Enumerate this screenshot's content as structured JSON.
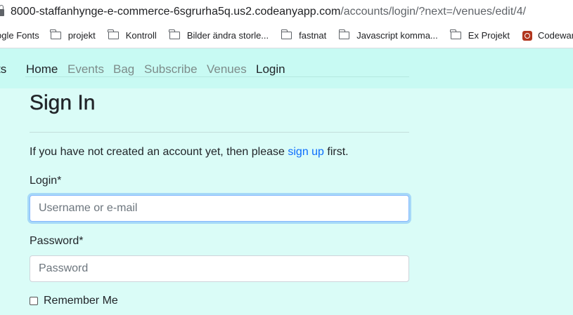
{
  "browser": {
    "url_host": "8000-staffanhynge-e-commerce-6sgrurha5q.us2.codeanyapp.com",
    "url_path": "/accounts/login/?next=/venues/edit/4/",
    "bookmarks": [
      {
        "label": "ogle Fonts",
        "icon": "none"
      },
      {
        "label": "projekt",
        "icon": "folder-icon"
      },
      {
        "label": "Kontroll",
        "icon": "folder-icon"
      },
      {
        "label": "Bilder ändra storle...",
        "icon": "folder-icon"
      },
      {
        "label": "fastnat",
        "icon": "folder-icon"
      },
      {
        "label": "Javascript komma...",
        "icon": "folder-icon"
      },
      {
        "label": "Ex Projekt",
        "icon": "folder-icon"
      },
      {
        "label": "Codewars -",
        "icon": "codewars-icon"
      }
    ]
  },
  "navbar": {
    "brand_tail": "ts",
    "items": [
      {
        "label": "Home",
        "active": true
      },
      {
        "label": "Events",
        "active": false
      },
      {
        "label": "Bag",
        "active": false
      },
      {
        "label": "Subscribe",
        "active": false
      },
      {
        "label": "Venues",
        "active": false
      },
      {
        "label": "Login",
        "active": true
      }
    ]
  },
  "form": {
    "title": "Sign In",
    "intro_before": "If you have not created an account yet, then please ",
    "signup_link": "sign up",
    "intro_after": " first.",
    "login_label": "Login*",
    "login_placeholder": "Username or e-mail",
    "password_label": "Password*",
    "password_placeholder": "Password",
    "remember_label": "Remember Me"
  },
  "colors": {
    "page_background": "#dafcf7",
    "navbar_background": "#c8faf3",
    "link": "#0d6efd",
    "focus_ring": "#86b7fe"
  }
}
